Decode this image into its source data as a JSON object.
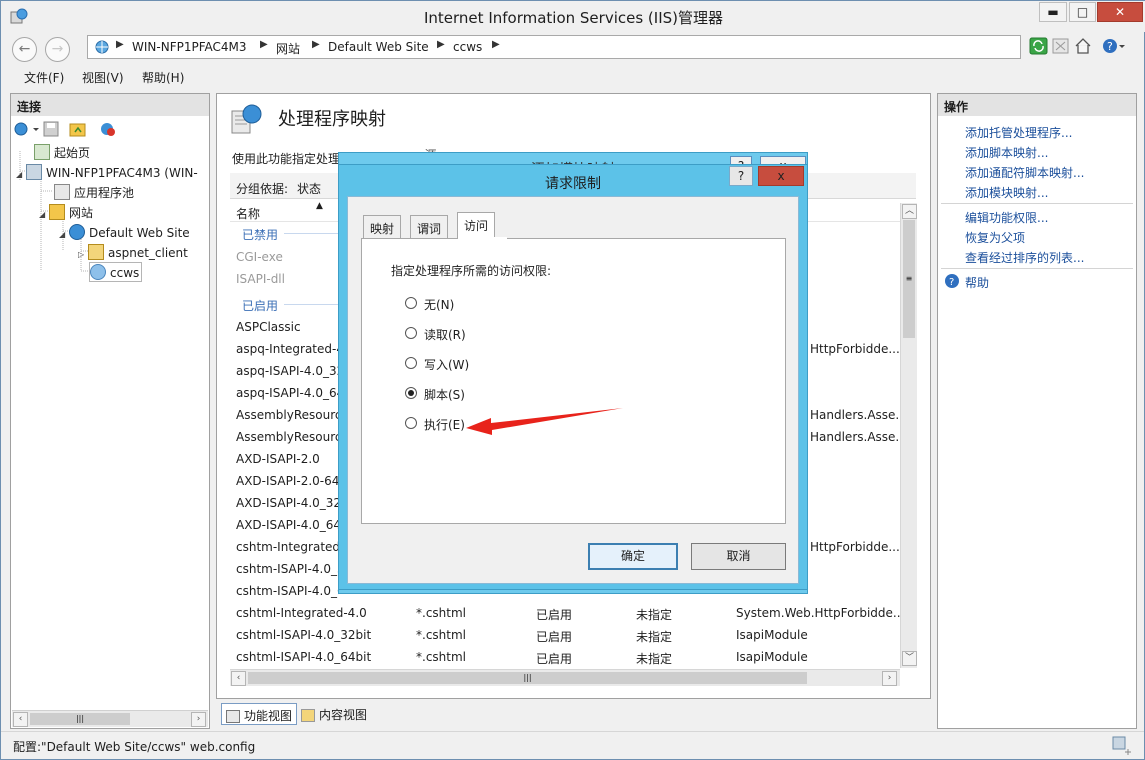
{
  "window": {
    "title": "Internet Information Services (IIS)管理器"
  },
  "address": {
    "crumbs": [
      "WIN-NFP1PFAC4M3",
      "网站",
      "Default Web Site",
      "ccws"
    ]
  },
  "menubar": {
    "items": [
      "文件(F)",
      "视图(V)",
      "帮助(H)"
    ]
  },
  "connections": {
    "header": "连接",
    "tree": [
      "起始页",
      "WIN-NFP1PFAC4M3 (WIN-",
      "应用程序池",
      "网站",
      "Default Web Site",
      "aspnet_client",
      "ccws"
    ]
  },
  "main": {
    "title": "处理程序映射",
    "description": "使用此功能指定处理",
    "description_tail": "...源",
    "group_label": "分组依据:",
    "group_value": "状态",
    "column_name": "名称",
    "group_disabled": "已禁用",
    "group_enabled": "已启用",
    "disabled_rows": [
      "CGI-exe",
      "ISAPI-dll"
    ],
    "enabled_rows": [
      {
        "name": "ASPClassic",
        "handler": ""
      },
      {
        "name": "aspq-Integrated-4",
        "handler": "HttpForbidde..."
      },
      {
        "name": "aspq-ISAPI-4.0_32",
        "handler": ""
      },
      {
        "name": "aspq-ISAPI-4.0_64",
        "handler": ""
      },
      {
        "name": "AssemblyResourc",
        "handler": "Handlers.Asse..."
      },
      {
        "name": "AssemblyResourc",
        "handler": "Handlers.Asse..."
      },
      {
        "name": "AXD-ISAPI-2.0",
        "handler": ""
      },
      {
        "name": "AXD-ISAPI-2.0-64",
        "handler": ""
      },
      {
        "name": "AXD-ISAPI-4.0_32",
        "handler": ""
      },
      {
        "name": "AXD-ISAPI-4.0_64",
        "handler": ""
      },
      {
        "name": "cshtm-Integrated-",
        "handler": "HttpForbidde..."
      },
      {
        "name": "cshtm-ISAPI-4.0_3",
        "handler": ""
      },
      {
        "name": "cshtm-ISAPI-4.0_6",
        "handler": ""
      }
    ],
    "full_rows": [
      {
        "name": "cshtml-Integrated-4.0",
        "path": "*.cshtml",
        "state": "已启用",
        "type": "未指定",
        "handler": "System.Web.HttpForbidde..."
      },
      {
        "name": "cshtml-ISAPI-4.0_32bit",
        "path": "*.cshtml",
        "state": "已启用",
        "type": "未指定",
        "handler": "IsapiModule"
      },
      {
        "name": "cshtml-ISAPI-4.0_64bit",
        "path": "*.cshtml",
        "state": "已启用",
        "type": "未指定",
        "handler": "IsapiModule"
      }
    ],
    "bottom_tabs": [
      "功能视图",
      "内容视图"
    ]
  },
  "actions": {
    "header": "操作",
    "links": [
      "添加托管处理程序...",
      "添加脚本映射...",
      "添加通配符脚本映射...",
      "添加模块映射...",
      "编辑功能权限...",
      "恢复为父项",
      "查看经过排序的列表...",
      "帮助"
    ]
  },
  "status_bar": {
    "text": "配置:\"Default Web Site/ccws\" web.config"
  },
  "back_dialog": {
    "title": "添加模块映射",
    "help": "?",
    "close": "x"
  },
  "dialog": {
    "title": "请求限制",
    "help": "?",
    "close": "x",
    "tabs": [
      "映射",
      "谓词",
      "访问"
    ],
    "prompt": "指定处理程序所需的访问权限:",
    "options": [
      "无(N)",
      "读取(R)",
      "写入(W)",
      "脚本(S)",
      "执行(E)"
    ],
    "selected_option": "脚本(S)",
    "ok": "确定",
    "cancel": "取消"
  },
  "colors": {
    "dialog_frame": "#5cc2e8",
    "link": "#1b4f9b",
    "annotation_arrow": "#e8231b",
    "close_button": "#c74d3e"
  }
}
